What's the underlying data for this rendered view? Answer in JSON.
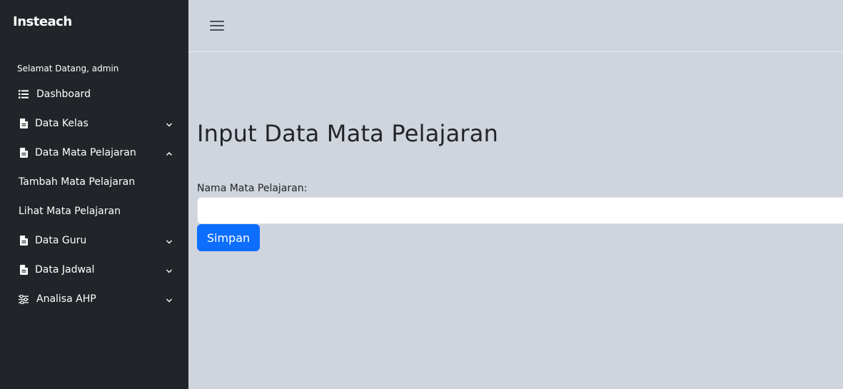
{
  "sidebar": {
    "brand": "Insteach",
    "welcome": "Selamat Datang, admin",
    "items": [
      {
        "label": "Dashboard",
        "icon": "list-icon"
      },
      {
        "label": "Data Kelas",
        "icon": "document-icon",
        "expanded": false
      },
      {
        "label": "Data Mata Pelajaran",
        "icon": "document-icon",
        "expanded": true
      },
      {
        "label": "Tambah Mata Pelajaran"
      },
      {
        "label": "Lihat Mata Pelajaran"
      },
      {
        "label": "Data Guru",
        "icon": "document-icon",
        "expanded": false
      },
      {
        "label": "Data Jadwal",
        "icon": "document-icon",
        "expanded": false
      },
      {
        "label": "Analisa AHP",
        "icon": "sliders-icon",
        "expanded": false
      }
    ]
  },
  "header": {
    "menu_icon": "hamburger-icon"
  },
  "main": {
    "title": "Input Data Mata Pelajaran",
    "field_label": "Nama Mata Pelajaran:",
    "field_value": "",
    "submit_label": "Simpan"
  },
  "colors": {
    "sidebar_bg": "#212529",
    "content_bg": "#cfd4dd",
    "primary": "#0d6efd"
  }
}
